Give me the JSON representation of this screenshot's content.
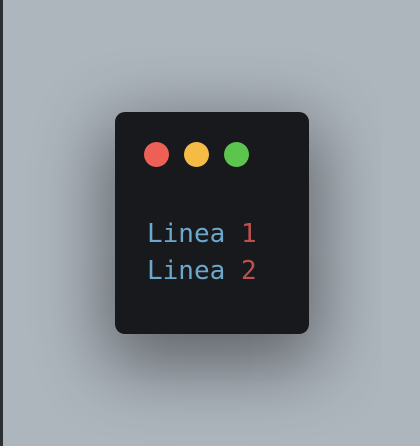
{
  "window": {
    "controls": [
      {
        "name": "close",
        "color": "#ee5f56"
      },
      {
        "name": "minimize",
        "color": "#f6bb45"
      },
      {
        "name": "maximize",
        "color": "#5cc54d"
      }
    ],
    "code_lines": [
      {
        "word": "Linea",
        "number": "1"
      },
      {
        "word": "Linea",
        "number": "2"
      }
    ]
  }
}
